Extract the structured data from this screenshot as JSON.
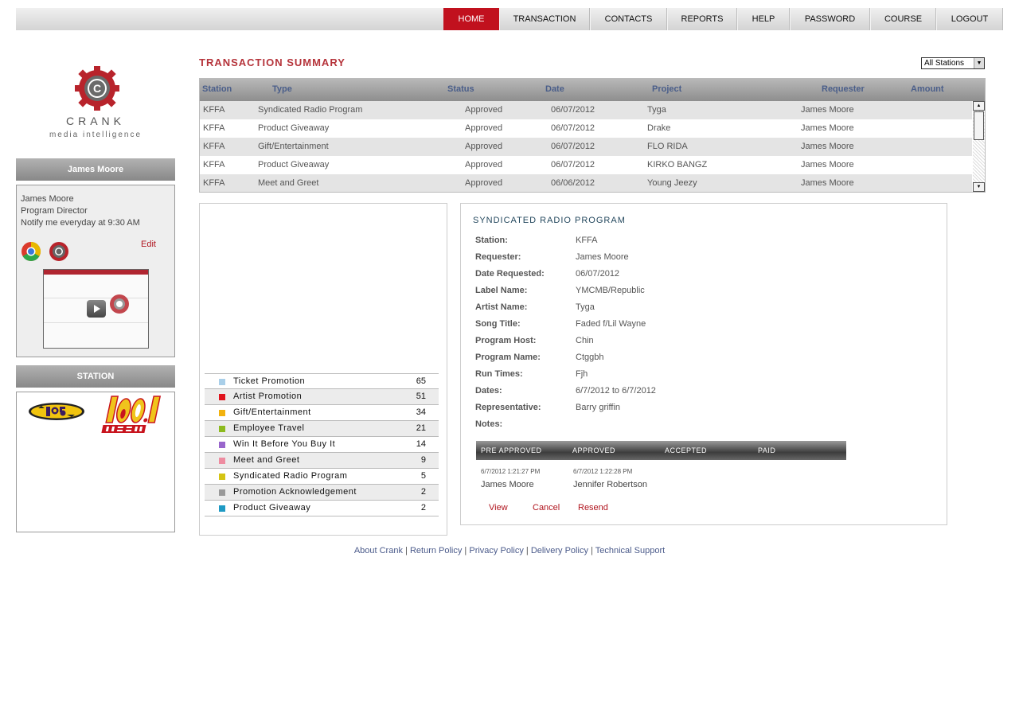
{
  "nav": {
    "items": [
      "HOME",
      "TRANSACTION",
      "CONTACTS",
      "REPORTS",
      "HELP",
      "PASSWORD",
      "COURSE",
      "LOGOUT"
    ],
    "active": "HOME"
  },
  "logo": {
    "brand": "CRANK",
    "tagline": "media intelligence"
  },
  "user": {
    "header": "James Moore",
    "name": "James Moore",
    "role": "Program Director",
    "notify": "Notify me everyday at 9:30 AM",
    "edit_label": "Edit"
  },
  "station_panel": {
    "header": "STATION"
  },
  "summary": {
    "title": "TRANSACTION SUMMARY",
    "station_filter": "All Stations",
    "columns": [
      "Station",
      "Type",
      "Status",
      "Date",
      "Project",
      "Requester",
      "Amount"
    ],
    "rows": [
      [
        "KFFA",
        "Syndicated Radio Program",
        "Approved",
        "06/07/2012",
        "Tyga",
        "James Moore",
        ""
      ],
      [
        "KFFA",
        "Product Giveaway",
        "Approved",
        "06/07/2012",
        "Drake",
        "James Moore",
        ""
      ],
      [
        "KFFA",
        "Gift/Entertainment",
        "Approved",
        "06/07/2012",
        "FLO RIDA",
        "James Moore",
        ""
      ],
      [
        "KFFA",
        "Product Giveaway",
        "Approved",
        "06/07/2012",
        "KIRKO BANGZ",
        "James Moore",
        ""
      ],
      [
        "KFFA",
        "Meet and Greet",
        "Approved",
        "06/06/2012",
        "Young Jeezy",
        "James Moore",
        ""
      ]
    ]
  },
  "legend": [
    {
      "label": "Ticket Promotion",
      "count": "65",
      "color": "#a9cfe9"
    },
    {
      "label": "Artist Promotion",
      "count": "51",
      "color": "#e0141e"
    },
    {
      "label": "Gift/Entertainment",
      "count": "34",
      "color": "#f2b20e"
    },
    {
      "label": "Employee Travel",
      "count": "21",
      "color": "#8cba1e"
    },
    {
      "label": "Win It Before You Buy It",
      "count": "14",
      "color": "#9966cc"
    },
    {
      "label": "Meet and Greet",
      "count": "9",
      "color": "#ee8ca0"
    },
    {
      "label": "Syndicated Radio Program",
      "count": "5",
      "color": "#d4c414"
    },
    {
      "label": "Promotion Acknowledgement",
      "count": "2",
      "color": "#999999"
    },
    {
      "label": "Product Giveaway",
      "count": "2",
      "color": "#1f9ac4"
    }
  ],
  "detail": {
    "title": "SYNDICATED RADIO PROGRAM",
    "fields": [
      {
        "label": "Station:",
        "value": "KFFA"
      },
      {
        "label": "Requester:",
        "value": "James Moore"
      },
      {
        "label": "Date Requested:",
        "value": "06/07/2012"
      },
      {
        "label": "Label Name:",
        "value": "YMCMB/Republic"
      },
      {
        "label": "Artist Name:",
        "value": "Tyga"
      },
      {
        "label": "Song Title:",
        "value": "Faded f/Lil Wayne"
      },
      {
        "label": "Program Host:",
        "value": "Chin"
      },
      {
        "label": "Program Name:",
        "value": "Ctggbh"
      },
      {
        "label": "Run Times:",
        "value": "Fjh"
      },
      {
        "label": "Dates:",
        "value": "6/7/2012 to 6/7/2012"
      },
      {
        "label": "Representative:",
        "value": "Barry griffin"
      },
      {
        "label": "Notes:",
        "value": ""
      }
    ],
    "status_headers": [
      "PRE APPROVED",
      "APPROVED",
      "ACCEPTED",
      "PAID"
    ],
    "status_times": [
      "6/7/2012 1:21:27 PM",
      "6/7/2012 1:22:28 PM"
    ],
    "status_names": [
      "James Moore",
      "Jennifer Robertson"
    ],
    "actions": [
      "View",
      "Cancel",
      "Resend"
    ]
  },
  "footer": {
    "links": [
      "About Crank",
      "Return Policy",
      "Privacy Policy",
      "Delivery Policy",
      "Technical Support"
    ],
    "separator": " | "
  },
  "colors": {
    "accent": "#c1111e",
    "title": "#b5333a",
    "header_text": "#4a5e8a"
  }
}
